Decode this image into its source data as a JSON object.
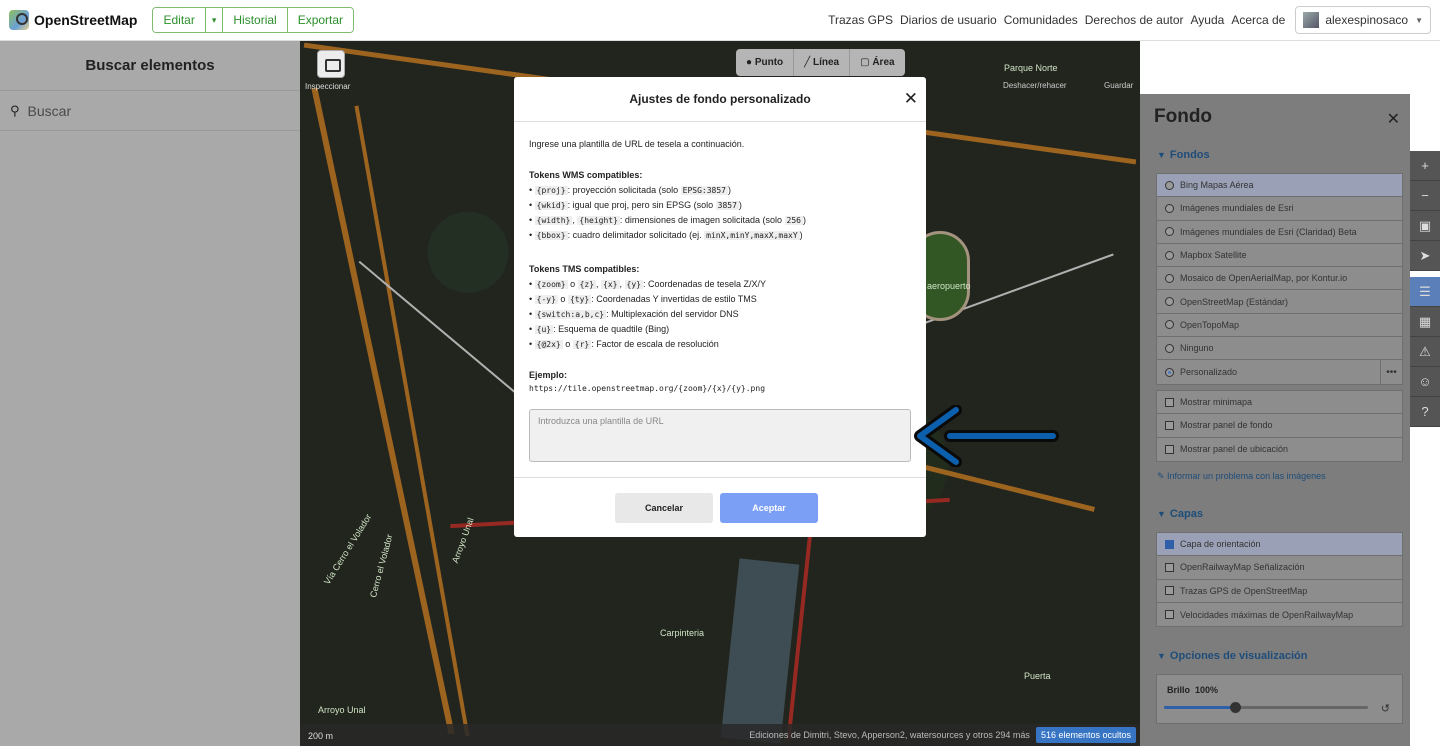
{
  "navbar": {
    "logo_text": "OpenStreetMap",
    "edit_label": "Editar",
    "history_label": "Historial",
    "export_label": "Exportar",
    "links": [
      "Trazas GPS",
      "Diarios de usuario",
      "Comunidades",
      "Derechos de autor",
      "Ayuda",
      "Acerca de"
    ],
    "username": "alexespinosaco"
  },
  "sidebar": {
    "title": "Buscar elementos",
    "search_placeholder": "Buscar"
  },
  "map": {
    "inspect_label": "Inspeccionar",
    "tools": {
      "point": "Punto",
      "line": "Línea",
      "area": "Área"
    },
    "labels": {
      "parque": "Parque Norte",
      "aeropuerto": "aeropuerto",
      "carpinteria": "Carpinteria",
      "arroyo1": "Arroyo Unal",
      "arroyo2": "Arroyo Unal",
      "volador": "Vía Cerro el Volador",
      "cerro": "Cerro el Volador",
      "puerta": "Puerta"
    },
    "undo_label": "Deshacer/rehacer",
    "save_label": "Guardar",
    "scale": "200 m",
    "footer_edits": "Ediciones de Dimitri, Stevo, Apperson2, watersources y otros 294 más",
    "hidden_count": "516 elementos ocultos"
  },
  "panel": {
    "title": "Fondo",
    "backgrounds_section": "Fondos",
    "backgrounds": [
      {
        "label": "Bing Mapas Aérea",
        "selected": false,
        "highlight": true
      },
      {
        "label": "Imágenes mundiales de Esri",
        "selected": false
      },
      {
        "label": "Imágenes mundiales de Esri (Claridad) Beta",
        "selected": false
      },
      {
        "label": "Mapbox Satellite",
        "selected": false
      },
      {
        "label": "Mosaico de OpenAerialMap, por Kontur.io",
        "selected": false
      },
      {
        "label": "OpenStreetMap (Estándar)",
        "selected": false
      },
      {
        "label": "OpenTopoMap",
        "selected": false
      },
      {
        "label": "Ninguno",
        "selected": false
      },
      {
        "label": "Personalizado",
        "selected": true
      }
    ],
    "options": [
      "Mostrar minimapa",
      "Mostrar panel de fondo",
      "Mostrar panel de ubicación"
    ],
    "report_link": "Informar un problema con las imágenes",
    "layers_section": "Capas",
    "layers": [
      {
        "label": "Capa de orientación",
        "checked": true
      },
      {
        "label": "OpenRailwayMap Señalización",
        "checked": false
      },
      {
        "label": "Trazas GPS de OpenStreetMap",
        "checked": false
      },
      {
        "label": "Velocidades máximas de OpenRailwayMap",
        "checked": false
      }
    ],
    "display_section": "Opciones de visualización",
    "brightness_label": "Brillo",
    "brightness_value": "100%",
    "brightness_level": 0.35
  },
  "modal": {
    "title": "Ajustes de fondo personalizado",
    "intro": "Ingrese una plantilla de URL de tesela a continuación.",
    "wms_title": "Tokens WMS compatibles:",
    "wms": [
      [
        [
          "code",
          "{proj}"
        ],
        [
          "t",
          ": proyección solicitada (solo "
        ],
        [
          "code",
          "EPSG:3857"
        ],
        [
          "t",
          ")"
        ]
      ],
      [
        [
          "code",
          "{wkid}"
        ],
        [
          "t",
          ": igual que proj, pero sin EPSG (solo "
        ],
        [
          "code",
          "3857"
        ],
        [
          "t",
          ")"
        ]
      ],
      [
        [
          "code",
          "{width}"
        ],
        [
          "t",
          ", "
        ],
        [
          "code",
          "{height}"
        ],
        [
          "t",
          ": dimensiones de imagen solicitada (solo "
        ],
        [
          "code",
          "256"
        ],
        [
          "t",
          ")"
        ]
      ],
      [
        [
          "code",
          "{bbox}"
        ],
        [
          "t",
          ": cuadro delimitador solicitado (ej. "
        ],
        [
          "code",
          "minX,minY,maxX,maxY"
        ],
        [
          "t",
          ")"
        ]
      ]
    ],
    "tms_title": "Tokens TMS compatibles:",
    "tms": [
      [
        [
          "code",
          "{zoom}"
        ],
        [
          "t",
          " o "
        ],
        [
          "code",
          "{z}"
        ],
        [
          "t",
          ", "
        ],
        [
          "code",
          "{x}"
        ],
        [
          "t",
          ", "
        ],
        [
          "code",
          "{y}"
        ],
        [
          "t",
          ": Coordenadas de tesela Z/X/Y"
        ]
      ],
      [
        [
          "code",
          "{-y}"
        ],
        [
          "t",
          " o "
        ],
        [
          "code",
          "{ty}"
        ],
        [
          "t",
          ": Coordenadas Y invertidas de estilo TMS"
        ]
      ],
      [
        [
          "code",
          "{switch:a,b,c}"
        ],
        [
          "t",
          ": Multiplexación del servidor DNS"
        ]
      ],
      [
        [
          "code",
          "{u}"
        ],
        [
          "t",
          ": Esquema de quadtile (Bing)"
        ]
      ],
      [
        [
          "code",
          "{@2x}"
        ],
        [
          "t",
          " o "
        ],
        [
          "code",
          "{r}"
        ],
        [
          "t",
          ": Factor de escala de resolución"
        ]
      ]
    ],
    "example_title": "Ejemplo:",
    "example": "https://tile.openstreetmap.org/{zoom}/{x}/{y}.png",
    "input_placeholder": "Introduzca una plantilla de URL",
    "cancel_label": "Cancelar",
    "accept_label": "Aceptar"
  },
  "colors": {
    "accent": "#7ebc6f",
    "accept": "#7a9ff5",
    "arrow": "#0b5fad"
  }
}
